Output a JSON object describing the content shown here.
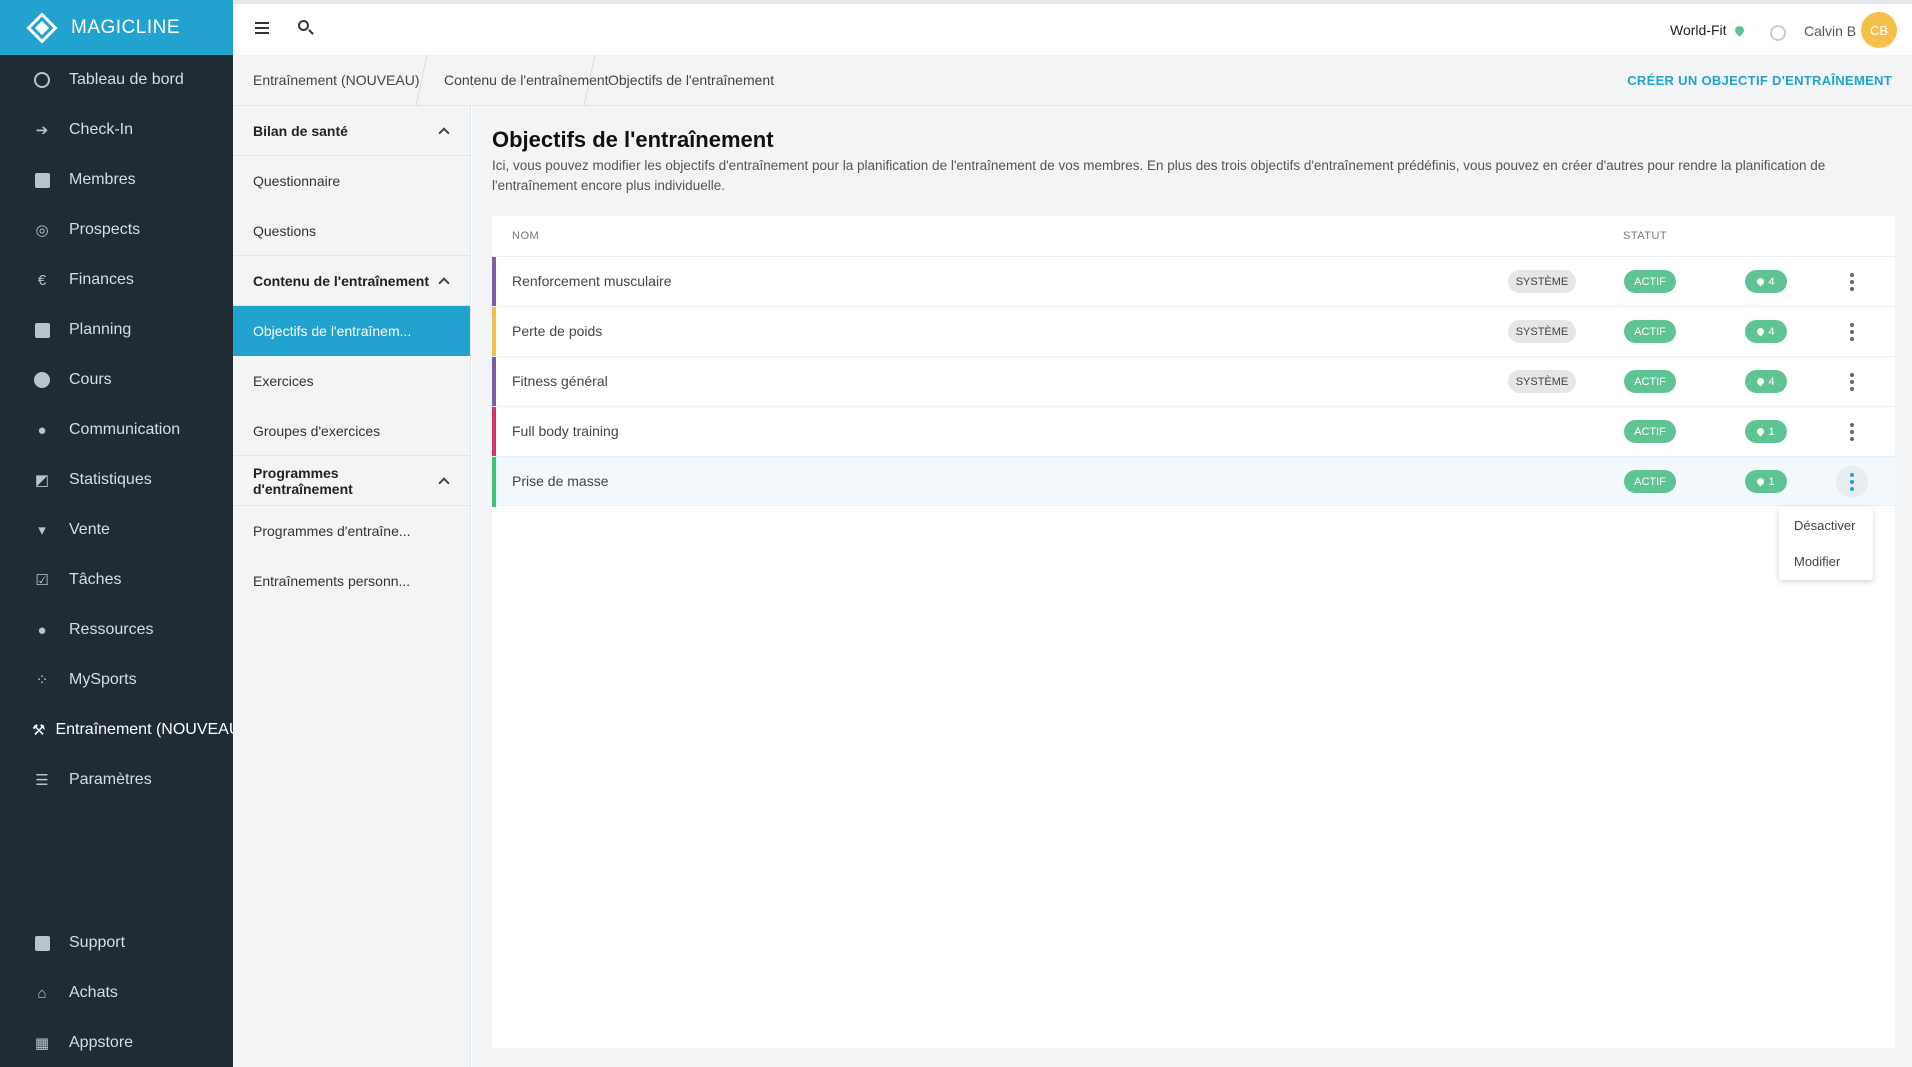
{
  "app": {
    "logo_text": "MAGICLINE"
  },
  "sidebar": {
    "items": [
      {
        "label": "Tableau de bord",
        "icon": "dashboard-icon"
      },
      {
        "label": "Check-In",
        "icon": "checkin-icon"
      },
      {
        "label": "Membres",
        "icon": "members-icon"
      },
      {
        "label": "Prospects",
        "icon": "prospects-icon"
      },
      {
        "label": "Finances",
        "icon": "euro-icon"
      },
      {
        "label": "Planning",
        "icon": "calendar-icon"
      },
      {
        "label": "Cours",
        "icon": "stopwatch-icon"
      },
      {
        "label": "Communication",
        "icon": "chat-icon"
      },
      {
        "label": "Statistiques",
        "icon": "chart-icon"
      },
      {
        "label": "Vente",
        "icon": "cart-icon"
      },
      {
        "label": "Tâches",
        "icon": "checkbox-icon"
      },
      {
        "label": "Ressources",
        "icon": "group-icon"
      },
      {
        "label": "MySports",
        "icon": "dots-grid-icon"
      },
      {
        "label": "Entraînement (NOUVEAU)",
        "icon": "dumbbell-icon"
      },
      {
        "label": "Paramètres",
        "icon": "sliders-icon"
      }
    ],
    "bottom_items": [
      {
        "label": "Support",
        "icon": "help-icon"
      },
      {
        "label": "Achats",
        "icon": "store-icon"
      },
      {
        "label": "Appstore",
        "icon": "apps-icon"
      }
    ]
  },
  "topbar": {
    "studio": "World-Fit",
    "user_name": "Calvin B",
    "avatar_initials": "CB"
  },
  "breadcrumb": {
    "items": [
      "Entraînement (NOUVEAU)",
      "Contenu de l'entraînement",
      "Objectifs de l'entraînement"
    ],
    "action": "CRÉER UN OBJECTIF D'ENTRAÎNEMENT"
  },
  "subnav": {
    "sections": [
      {
        "title": "Bilan de santé",
        "items": [
          "Questionnaire",
          "Questions"
        ]
      },
      {
        "title": "Contenu de l'entraînement",
        "items": [
          "Objectifs de l'entraînem...",
          "Exercices",
          "Groupes d'exercices"
        ]
      },
      {
        "title": "Programmes d'entraînement",
        "items": [
          "Programmes d'entraîne...",
          "Entraînements personn..."
        ]
      }
    ]
  },
  "page": {
    "title": "Objectifs de l'entraînement",
    "description": "Ici, vous pouvez modifier les objectifs d'entraînement pour la planification de l'entraînement de vos membres. En plus des trois objectifs d'entraînement prédéfinis, vous pouvez en créer d'autres pour rendre la planification de l'entraînement encore plus individuelle."
  },
  "table": {
    "columns": {
      "name": "NOM",
      "status": "STATUT"
    },
    "rows": [
      {
        "name": "Renforcement musculaire",
        "system": "SYSTÈME",
        "status": "ACTIF",
        "count": "4",
        "color": "#7b5ea7"
      },
      {
        "name": "Perte de poids",
        "system": "SYSTÈME",
        "status": "ACTIF",
        "count": "4",
        "color": "#f2c14e"
      },
      {
        "name": "Fitness général",
        "system": "SYSTÈME",
        "status": "ACTIF",
        "count": "4",
        "color": "#7b5ea7"
      },
      {
        "name": "Full body training",
        "system": "",
        "status": "ACTIF",
        "count": "1",
        "color": "#d6336c"
      },
      {
        "name": "Prise de masse",
        "system": "",
        "status": "ACTIF",
        "count": "1",
        "color": "#3cc46e"
      }
    ]
  },
  "context_menu": {
    "items": [
      "Désactiver",
      "Modifier"
    ]
  },
  "colors": {
    "accent": "#21a2cf",
    "sidebar": "#1f2c36",
    "active_green": "#5ec493"
  }
}
